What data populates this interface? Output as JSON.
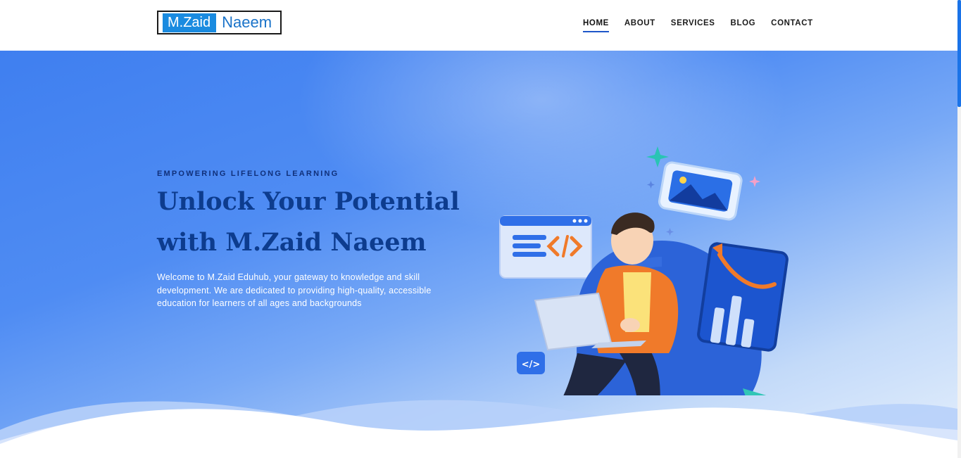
{
  "logo": {
    "part1": "M.Zaid",
    "part2": "Naeem"
  },
  "nav": {
    "home": "HOME",
    "about": "ABOUT",
    "services": "SERVICES",
    "blog": "BLOG",
    "contact": "CONTACT"
  },
  "hero": {
    "eyebrow": "EMPOWERING LIFELONG LEARNING",
    "title_line1": "Unlock Your Potential",
    "title_line2": "with M.Zaid Naeem",
    "description": "Welcome to M.Zaid Eduhub, your gateway to knowledge and skill development. We are dedicated to providing high-quality, accessible education for learners of all ages and backgrounds"
  },
  "colors": {
    "brand_blue": "#1a8be0",
    "title_navy": "#0d3c8e",
    "accent_orange": "#f07a2a",
    "hero_blue": "#3f7ff0"
  },
  "illustration": {
    "name": "student-laptop-illustration",
    "code_icon": "</>"
  }
}
